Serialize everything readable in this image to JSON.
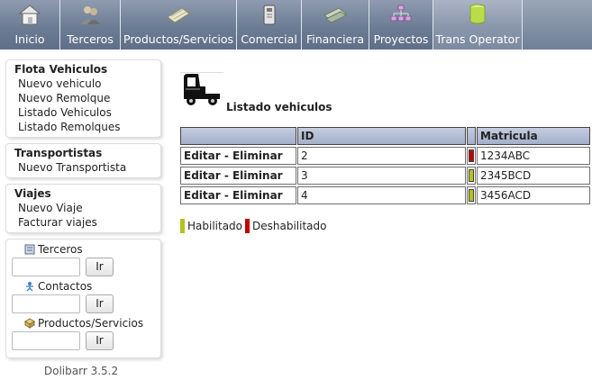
{
  "menu": {
    "tabs": [
      {
        "label": "Inicio",
        "icon": "home-icon"
      },
      {
        "label": "Terceros",
        "icon": "users-icon"
      },
      {
        "label": "Productos/Servicios",
        "icon": "products-icon"
      },
      {
        "label": "Comercial",
        "icon": "commercial-icon"
      },
      {
        "label": "Financiera",
        "icon": "money-icon"
      },
      {
        "label": "Proyectos",
        "icon": "project-icon"
      },
      {
        "label": "Trans Operator",
        "icon": "cylinder-icon"
      }
    ],
    "active": "Trans Operator"
  },
  "sidebar": {
    "flota": {
      "title": "Flota Vehiculos",
      "items": [
        "Nuevo vehiculo",
        "Nuevo Remolque",
        "Listado Vehiculos",
        "Listado Remolques"
      ]
    },
    "transportistas": {
      "title": "Transportistas",
      "items": [
        "Nuevo Transportista"
      ]
    },
    "viajes": {
      "title": "Viajes",
      "items": [
        "Nuevo Viaje",
        "Facturar viajes"
      ]
    },
    "quicksearch": [
      {
        "label": "Terceros",
        "icon": "building-icon",
        "button": "Ir"
      },
      {
        "label": "Contactos",
        "icon": "contact-person-icon",
        "button": "Ir"
      },
      {
        "label": "Productos/Servicios",
        "icon": "box-icon",
        "button": "Ir"
      }
    ],
    "version": "Dolibarr 3.5.2"
  },
  "page": {
    "title": "Listado vehiculos"
  },
  "table": {
    "headers": [
      "",
      "ID",
      "",
      "Matricula"
    ],
    "rows": [
      {
        "actions": "Editar - Eliminar",
        "id": "2",
        "status": "disabled",
        "matricula": "1234ABC"
      },
      {
        "actions": "Editar - Eliminar",
        "id": "3",
        "status": "enabled",
        "matricula": "2345BCD"
      },
      {
        "actions": "Editar - Eliminar",
        "id": "4",
        "status": "enabled",
        "matricula": "3456ACD"
      }
    ]
  },
  "legend": {
    "enabled_label": "Habilitado",
    "disabled_label": "Deshabilitado"
  },
  "colors": {
    "enabled": "#b5c21e",
    "disabled": "#c00000",
    "header_bg": "#b4bed6",
    "menu_bg": "#7a8aa2"
  }
}
